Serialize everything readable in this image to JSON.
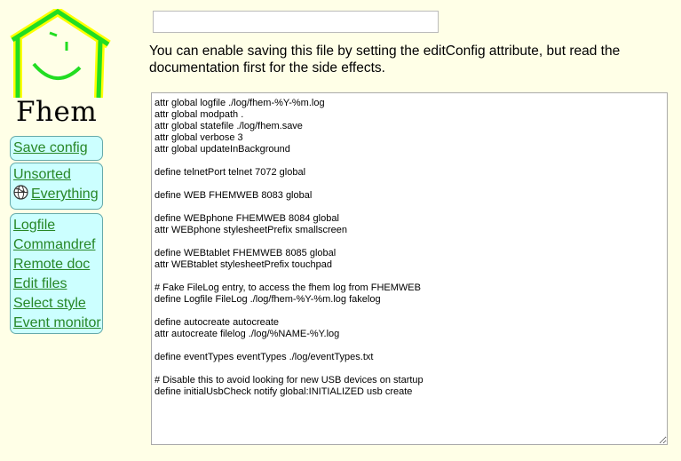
{
  "logo": {
    "text": "Fhem",
    "colors": {
      "house_stroke": "#22DD22",
      "house_outline": "#FFFF00"
    }
  },
  "menu": {
    "save_config": "Save config",
    "rooms": [
      {
        "label": "Unsorted"
      },
      {
        "label": "Everything",
        "icon": "globe-icon"
      }
    ],
    "tools": [
      {
        "label": "Logfile"
      },
      {
        "label": "Commandref"
      },
      {
        "label": "Remote doc"
      },
      {
        "label": "Edit files"
      },
      {
        "label": "Select style"
      },
      {
        "label": "Event monitor"
      }
    ]
  },
  "top_input": {
    "value": "",
    "placeholder": ""
  },
  "info_text": "You can enable saving this file by setting the editConfig attribute, but read the documentation first for the side effects.",
  "config_text": "attr global logfile ./log/fhem-%Y-%m.log\nattr global modpath .\nattr global statefile ./log/fhem.save\nattr global verbose 3\nattr global updateInBackground\n\ndefine telnetPort telnet 7072 global\n\ndefine WEB FHEMWEB 8083 global\n\ndefine WEBphone FHEMWEB 8084 global\nattr WEBphone stylesheetPrefix smallscreen\n\ndefine WEBtablet FHEMWEB 8085 global\nattr WEBtablet stylesheetPrefix touchpad\n\n# Fake FileLog entry, to access the fhem log from FHEMWEB\ndefine Logfile FileLog ./log/fhem-%Y-%m.log fakelog\n\ndefine autocreate autocreate\nattr autocreate filelog ./log/%NAME-%Y.log\n\ndefine eventTypes eventTypes ./log/eventTypes.txt\n\n# Disable this to avoid looking for new USB devices on startup\ndefine initialUsbCheck notify global:INITIALIZED usb create",
  "colors": {
    "page_background": "#FFFFE7",
    "menu_background": "#CCFFFF",
    "link": "#278727"
  }
}
